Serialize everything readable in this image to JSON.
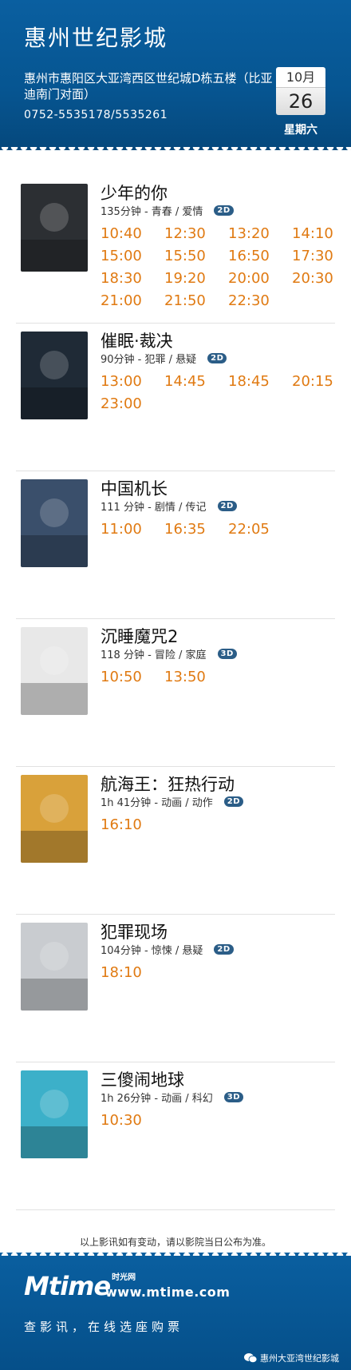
{
  "header": {
    "cinema_name": "惠州世纪影城",
    "address": "惠州市惠阳区大亚湾西区世纪城D栋五楼（比亚迪南门对面）",
    "phone": "0752-5535178/5535261",
    "calendar": {
      "month": "10月",
      "day": "26",
      "weekday": "星期六"
    }
  },
  "films": [
    {
      "title": "少年的你",
      "meta": "135分钟 - 青春 / 爱情",
      "format": "2D",
      "times": [
        "10:40",
        "12:30",
        "13:20",
        "14:10",
        "15:00",
        "15:50",
        "16:50",
        "17:30",
        "18:30",
        "19:20",
        "20:00",
        "20:30",
        "21:00",
        "21:50",
        "22:30"
      ],
      "poster_color": "#2c2f33"
    },
    {
      "title": "催眠·裁决",
      "meta": "90分钟 - 犯罪 / 悬疑",
      "format": "2D",
      "times": [
        "13:00",
        "14:45",
        "18:45",
        "20:15",
        "23:00"
      ],
      "poster_color": "#1f2a36"
    },
    {
      "title": "中国机长",
      "meta": "111 分钟 - 剧情 / 传记",
      "format": "2D",
      "times": [
        "11:00",
        "16:35",
        "22:05"
      ],
      "poster_color": "#3a4f6b"
    },
    {
      "title": "沉睡魔咒2",
      "meta": "118 分钟 - 冒险 / 家庭",
      "format": "3D",
      "times": [
        "10:50",
        "13:50"
      ],
      "poster_color": "#e8e8e8"
    },
    {
      "title": "航海王：狂热行动",
      "meta": "1h 41分钟 - 动画 / 动作",
      "format": "2D",
      "times": [
        "16:10"
      ],
      "poster_color": "#d9a13a"
    },
    {
      "title": "犯罪现场",
      "meta": "104分钟 - 惊悚 / 悬疑",
      "format": "2D",
      "times": [
        "18:10"
      ],
      "poster_color": "#c9ccd0"
    },
    {
      "title": "三傻闹地球",
      "meta": "1h 26分钟 - 动画 / 科幻",
      "format": "3D",
      "times": [
        "10:30"
      ],
      "poster_color": "#3cb0c9"
    }
  ],
  "notice": "以上影讯如有变动，请以影院当日公布为准。",
  "footer": {
    "logo_text": "Mtime",
    "logo_cn": "时光网",
    "url": "www.mtime.com",
    "slogan": "查影讯，在线选座购票",
    "wechat_account": "惠州大亚湾世纪影城"
  },
  "colors": {
    "header_blue": "#065591",
    "showtime_orange": "#e07a12",
    "badge_blue": "#2b5d87"
  }
}
